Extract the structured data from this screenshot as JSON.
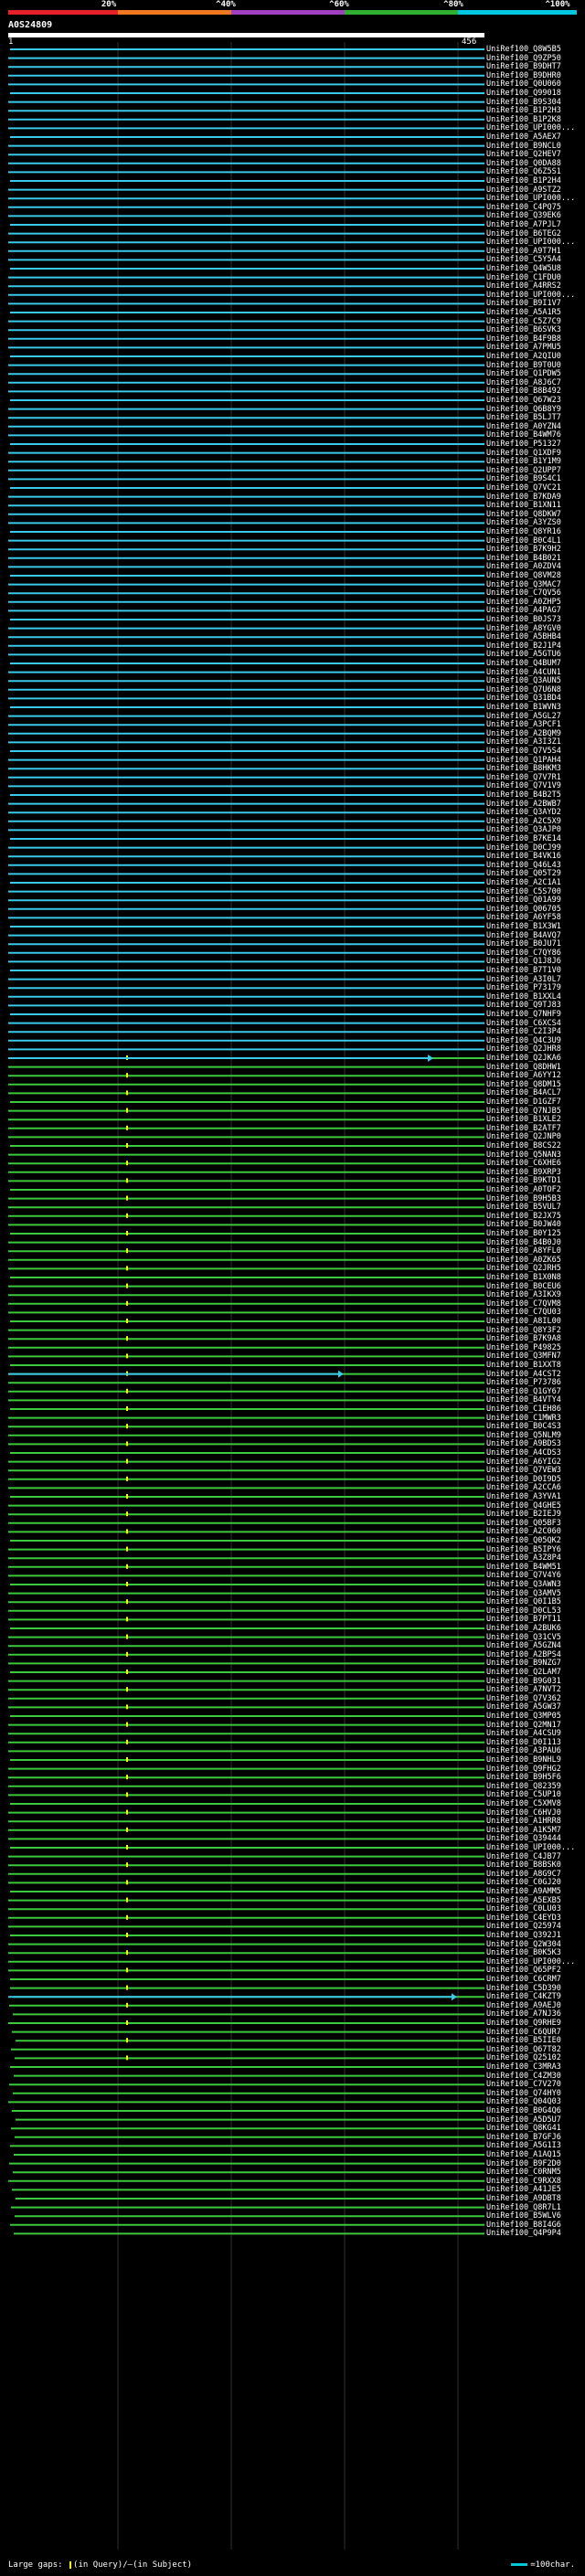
{
  "header": {
    "scale_labels": [
      "20%",
      "^40%",
      "^60%",
      "^80%",
      "^100%"
    ],
    "band_colors": [
      "#e8202a",
      "#f07820",
      "#a040c0",
      "#30b030",
      "#00c8e0"
    ],
    "query_id": "A0S24809",
    "query_start": "1",
    "query_end": "456"
  },
  "colors": {
    "high_identity": "#3cc8e8",
    "mid_identity": "#3cc83c",
    "gap": "#ffff00",
    "query": "#ffffff"
  },
  "hits": [
    "UniRef100_Q8W5B5",
    "UniRef100_Q9ZP50",
    "UniRef100_B9DHT7",
    "UniRef100_B9DHR0",
    "UniRef100_Q0U060",
    "UniRef100_Q99018",
    "UniRef100_B9S304",
    "UniRef100_B1P2H3",
    "UniRef100_B1P2K8",
    "UniRef100_UPI000...",
    "UniRef100_A5AEX7",
    "UniRef100_B9NCL0",
    "UniRef100_Q2HEV7",
    "UniRef100_Q0DA88",
    "UniRef100_Q6Z5S1",
    "UniRef100_B1P2H4",
    "UniRef100_A9STZ2",
    "UniRef100_UPI000...",
    "UniRef100_C4PQ75",
    "UniRef100_Q39EK6",
    "UniRef100_A7PJL7",
    "UniRef100_B6TEG2",
    "UniRef100_UPI000...",
    "UniRef100_A9T7H1",
    "UniRef100_C5Y5A4",
    "UniRef100_Q4W5U8",
    "UniRef100_C1FDU0",
    "UniRef100_A4RRS2",
    "UniRef100_UPI000...",
    "UniRef100_B9I1V7",
    "UniRef100_A5A1R5",
    "UniRef100_C5Z7C9",
    "UniRef100_B6SVK3",
    "UniRef100_B4F9B8",
    "UniRef100_A7PMU5",
    "UniRef100_A2QIU0",
    "UniRef100_B9T0U0",
    "UniRef100_Q1PDW5",
    "UniRef100_A8J6C7",
    "UniRef100_B8B492",
    "UniRef100_Q67W23",
    "UniRef100_Q6B8Y9",
    "UniRef100_B5LJT7",
    "UniRef100_A0YZN4",
    "UniRef100_B4WM76",
    "UniRef100_P51327",
    "UniRef100_Q1XDF9",
    "UniRef100_B1Y1M9",
    "UniRef100_Q2UPP7",
    "UniRef100_B9S4C1",
    "UniRef100_Q7VC21",
    "UniRef100_B7KDA9",
    "UniRef100_B1XN11",
    "UniRef100_Q8DKW7",
    "UniRef100_A3YZS0",
    "UniRef100_Q8YR16",
    "UniRef100_B0C4L1",
    "UniRef100_B7K9H2",
    "UniRef100_B4B021",
    "UniRef100_A0ZDV4",
    "UniRef100_Q8VM28",
    "UniRef100_Q3MAC7",
    "UniRef100_C7QV56",
    "UniRef100_A0ZHP5",
    "UniRef100_A4PAG7",
    "UniRef100_B0JS73",
    "UniRef100_A8YGV0",
    "UniRef100_A5BHB4",
    "UniRef100_B2J1P4",
    "UniRef100_A5GTU6",
    "UniRef100_Q4BUM7",
    "UniRef100_A4CUN1",
    "UniRef100_Q3AUN5",
    "UniRef100_Q7U6N8",
    "UniRef100_Q31BD4",
    "UniRef100_B1WVN3",
    "UniRef100_A5GL27",
    "UniRef100_A3PCF1",
    "UniRef100_A2BQM9",
    "UniRef100_A3I3Z1",
    "UniRef100_Q7V5S4",
    "UniRef100_Q1PAH4",
    "UniRef100_B8HKM3",
    "UniRef100_Q7V7R1",
    "UniRef100_Q7V1V9",
    "UniRef100_B4B2T5",
    "UniRef100_A2BWB7",
    "UniRef100_Q3AYD2",
    "UniRef100_A2C5X9",
    "UniRef100_Q3AJP0",
    "UniRef100_B7KE14",
    "UniRef100_D0CJ99",
    "UniRef100_B4VK16",
    "UniRef100_Q46L43",
    "UniRef100_Q05T29",
    "UniRef100_A2C1A1",
    "UniRef100_C5S700",
    "UniRef100_Q01A99",
    "UniRef100_Q06705",
    "UniRef100_A6YF58",
    "UniRef100_B1X3W1",
    "UniRef100_B4AVQ7",
    "UniRef100_B0JU71",
    "UniRef100_C7QY86",
    "UniRef100_Q1J8J6",
    "UniRef100_B7T1V0",
    "UniRef100_A3I0L7",
    "UniRef100_P73179",
    "UniRef100_B1XXL4",
    "UniRef100_Q9TJ83",
    "UniRef100_Q7NHF9",
    "UniRef100_C6XCS4",
    "UniRef100_C2I3P4",
    "UniRef100_Q4C3U9",
    "UniRef100_Q2JHR8",
    "UniRef100_Q2JKA6",
    "UniRef100_Q8DHW1",
    "UniRef100_A6YY12",
    "UniRef100_Q8DM15",
    "UniRef100_B4ACL7",
    "UniRef100_D1GZF7",
    "UniRef100_Q7NJB5",
    "UniRef100_B1XLE2",
    "UniRef100_B2ATF7",
    "UniRef100_Q2JNP0",
    "UniRef100_B8CS22",
    "UniRef100_Q5NAN3",
    "UniRef100_C6XHE6",
    "UniRef100_B9XRP3",
    "UniRef100_B9KTD1",
    "UniRef100_A0TOF2",
    "UniRef100_B9H5B3",
    "UniRef100_B5VUL7",
    "UniRef100_B2JX75",
    "UniRef100_B0JW40",
    "UniRef100_B0Y125",
    "UniRef100_B4B0J0",
    "UniRef100_A8YFL0",
    "UniRef100_A0ZK65",
    "UniRef100_Q2JRH5",
    "UniRef100_B1X0N8",
    "UniRef100_B0CEU6",
    "UniRef100_A3IKX9",
    "UniRef100_C7QVM8",
    "UniRef100_C7QU03",
    "UniRef100_A8IL00",
    "UniRef100_Q8Y3F2",
    "UniRef100_B7K9A8",
    "UniRef100_P49825",
    "UniRef100_Q3MFN7",
    "UniRef100_B1XXT8",
    "UniRef100_A4CST2",
    "UniRef100_P73786",
    "UniRef100_Q1GY67",
    "UniRef100_B4VTY4",
    "UniRef100_C1EH86",
    "UniRef100_C1MWR3",
    "UniRef100_B0C4S3",
    "UniRef100_Q5NLM9",
    "UniRef100_A9BDS3",
    "UniRef100_A4CDS3",
    "UniRef100_A6YIG2",
    "UniRef100_Q7VEW3",
    "UniRef100_D0I9D5",
    "UniRef100_A2CCA6",
    "UniRef100_A3YVA1",
    "UniRef100_Q4GHE5",
    "UniRef100_B2IEJ9",
    "UniRef100_Q05BF3",
    "UniRef100_A2C060",
    "UniRef100_Q05QK2",
    "UniRef100_B5IPY6",
    "UniRef100_A3Z8P4",
    "UniRef100_B4WM51",
    "UniRef100_Q7V4Y6",
    "UniRef100_Q3AWN3",
    "UniRef100_Q3AMV5",
    "UniRef100_Q0I1B5",
    "UniRef100_D0CL53",
    "UniRef100_B7PT11",
    "UniRef100_A2BUK6",
    "UniRef100_Q31CV5",
    "UniRef100_A5GZN4",
    "UniRef100_A2BPS4",
    "UniRef100_B9NZG7",
    "UniRef100_Q2LAM7",
    "UniRef100_B9G031",
    "UniRef100_A7NVT2",
    "UniRef100_Q7V362",
    "UniRef100_A5GW37",
    "UniRef100_Q3MP05",
    "UniRef100_Q2MN17",
    "UniRef100_A4CSU9",
    "UniRef100_D0I113",
    "UniRef100_A3PAU6",
    "UniRef100_B9NHL9",
    "UniRef100_Q9FHG2",
    "UniRef100_B9H5F6",
    "UniRef100_Q82359",
    "UniRef100_C5UP10",
    "UniRef100_C5XMV8",
    "UniRef100_C6HVJ0",
    "UniRef100_A1HRR8",
    "UniRef100_A1K5M7",
    "UniRef100_Q39444",
    "UniRef100_UPI000...",
    "UniRef100_C4JB77",
    "UniRef100_B8BSK0",
    "UniRef100_A8G9C7",
    "UniRef100_C0GJ20",
    "UniRef100_A9AMM5",
    "UniRef100_A5EXB5",
    "UniRef100_C0LU03",
    "UniRef100_C4EYD3",
    "UniRef100_Q25974",
    "UniRef100_Q392J1",
    "UniRef100_Q2W304",
    "UniRef100_B0K5K3",
    "UniRef100_UPI000...",
    "UniRef100_Q65PF2",
    "UniRef100_C6CRM7",
    "UniRef100_C5D390",
    "UniRef100_C4KZT9",
    "UniRef100_A9AEJ0",
    "UniRef100_A7NJ36",
    "UniRef100_Q9RHE9",
    "UniRef100_C6QUR7",
    "UniRef100_B5IIE0",
    "UniRef100_Q67T82",
    "UniRef100_Q25102",
    "UniRef100_C3MRA3",
    "UniRef100_C4ZM30",
    "UniRef100_C7V270",
    "UniRef100_Q74HY0",
    "UniRef100_Q04Q03",
    "UniRef100_B0G4Q6",
    "UniRef100_A5D5U7",
    "UniRef100_Q8KG41",
    "UniRef100_B7GFJ6",
    "UniRef100_A5G1I3",
    "UniRef100_A1AQ15",
    "UniRef100_B9F2D0",
    "UniRef100_C0RNM5",
    "UniRef100_C9RXX8",
    "UniRef100_A41JE5",
    "UniRef100_A9DBT8",
    "UniRef100_Q8R7L1",
    "UniRef100_B5WLV6",
    "UniRef100_B8I4G6",
    "UniRef100_Q4P9P4"
  ],
  "footer": {
    "gaps_text": "Large gaps: ",
    "gap_in_query": "(in Query)/",
    "gap_in_subject": "(in Subject)",
    "scale_text": "=100char."
  }
}
